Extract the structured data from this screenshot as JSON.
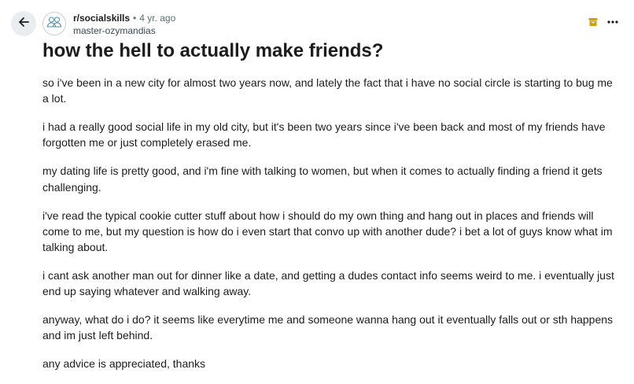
{
  "post": {
    "subreddit": "r/socialskills",
    "separator": "•",
    "age": "4 yr. ago",
    "author": "master-ozymandias",
    "title": "how the hell to actually make friends?",
    "paragraphs": [
      "so i've been in a new city for almost two years now, and lately the fact that i have no social circle is starting to bug me a lot.",
      "i had a really good social life in my old city, but it's been two years since i've been back and most of my friends have forgotten me or just completely erased me.",
      "my dating life is pretty good, and i'm fine with talking to women, but when it comes to actually finding a friend it gets challenging.",
      "i've read the typical cookie cutter stuff about how i should do my own thing and hang out in places and friends will come to me, but my question is how do i even start that convo up with another dude? i bet a lot of guys know what im talking about.",
      "i cant ask another man out for dinner like a date, and getting a dudes contact info seems weird to me. i eventually just end up saying whatever and walking away.",
      "anyway, what do i do? it seems like everytime me and someone wanna hang out it eventually falls out or sth happens and im just left behind.",
      "any advice is appreciated, thanks"
    ]
  },
  "icons": {
    "back": "arrow-left-icon",
    "avatar": "subreddit-avatar-icon",
    "archive": "archive-icon",
    "more": "more-options-icon"
  },
  "colors": {
    "archive_icon": "#d4a000",
    "back_button_bg": "#eaedef",
    "meta_text": "#576f76"
  }
}
